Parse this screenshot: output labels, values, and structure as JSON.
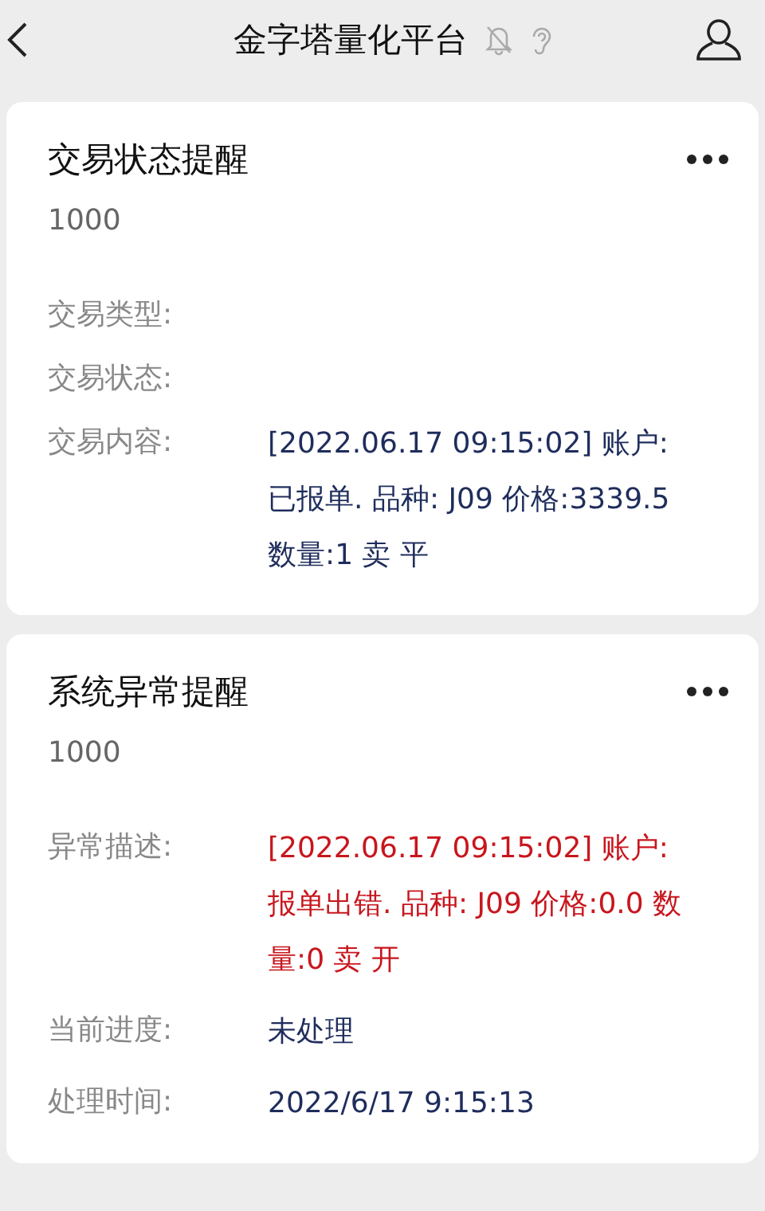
{
  "header": {
    "title": "金字塔量化平台"
  },
  "cards": [
    {
      "title": "交易状态提醒",
      "account": "1000",
      "fields": [
        {
          "label": "交易类型:"
        },
        {
          "label": "交易状态:"
        },
        {
          "label": "交易内容:",
          "value": "[2022.06.17 09:15:02] 账户: 已报单. 品种: J09 价格:3339.5 数量:1 卖 平",
          "color": "#1f2d5c"
        }
      ]
    },
    {
      "title": "系统异常提醒",
      "account": "1000",
      "fields": [
        {
          "label": "异常描述:",
          "value": "[2022.06.17 09:15:02] 账户: 报单出错. 品种: J09 价格:0.0 数量:0 卖 开",
          "color": "#c8161d"
        },
        {
          "label": "当前进度:",
          "value": "未处理",
          "color": "#1f2d5c"
        },
        {
          "label": "处理时间:",
          "value": "2022/6/17 9:15:13",
          "color": "#1f2d5c"
        }
      ]
    }
  ]
}
